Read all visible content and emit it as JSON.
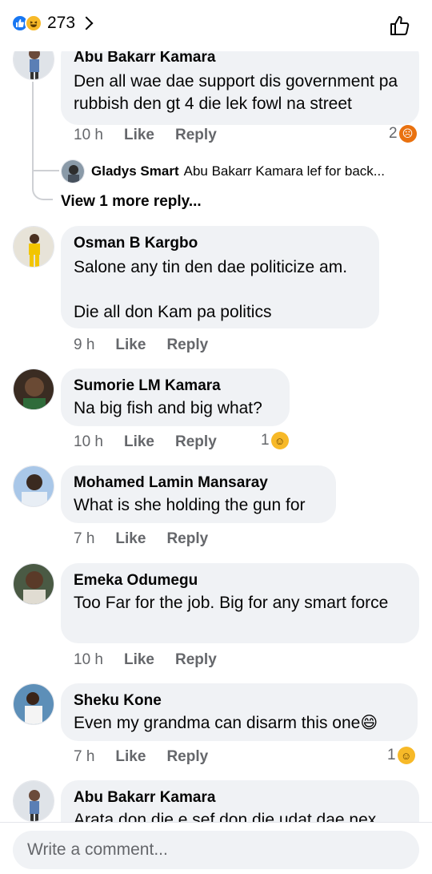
{
  "header": {
    "reaction_count": "273",
    "reaction_icons": [
      "like-icon",
      "haha-icon"
    ]
  },
  "comments": [
    {
      "author": "Abu Bakarr Kamara",
      "text": "Den all wae dae support dis government pa rubbish den gt 4 die lek fowl na street",
      "time": "10 h",
      "like": "Like",
      "reply": "Reply",
      "reaction_count": "2",
      "reaction_icon": "angry-icon",
      "reply_preview": {
        "author": "Gladys Smart",
        "text": "Abu Bakarr Kamara lef for back..."
      },
      "more_replies": "View 1 more reply..."
    },
    {
      "author": "Osman B Kargbo",
      "text": "Salone any tin den dae politicize am.\n\nDie all don Kam pa politics",
      "time": "9 h",
      "like": "Like",
      "reply": "Reply"
    },
    {
      "author": "Sumorie LM Kamara",
      "text": "Na big fish and big what?",
      "time": "10 h",
      "like": "Like",
      "reply": "Reply",
      "reaction_count": "1",
      "reaction_icon": "haha-icon"
    },
    {
      "author": "Mohamed Lamin Mansaray",
      "text": "What is she holding the gun for",
      "time": "7 h",
      "like": "Like",
      "reply": "Reply"
    },
    {
      "author": "Emeka Odumegu",
      "text": "Too Far for the job. Big for any smart force",
      "time": "10 h",
      "like": "Like",
      "reply": "Reply"
    },
    {
      "author": "Sheku Kone",
      "text": "Even my grandma can disarm this one😄",
      "time": "7 h",
      "like": "Like",
      "reply": "Reply",
      "reaction_count": "1",
      "reaction_icon": "haha-icon"
    },
    {
      "author": "Abu Bakarr Kamara",
      "text": "Arata don die e sef don die udat dae nex"
    }
  ],
  "composer": {
    "placeholder": "Write a comment..."
  },
  "colors": {
    "bubble": "#f0f2f5",
    "like_blue": "#1877f2",
    "haha_yellow": "#f7b928",
    "angry_orange": "#e9710f",
    "meta_gray": "#65676b"
  }
}
